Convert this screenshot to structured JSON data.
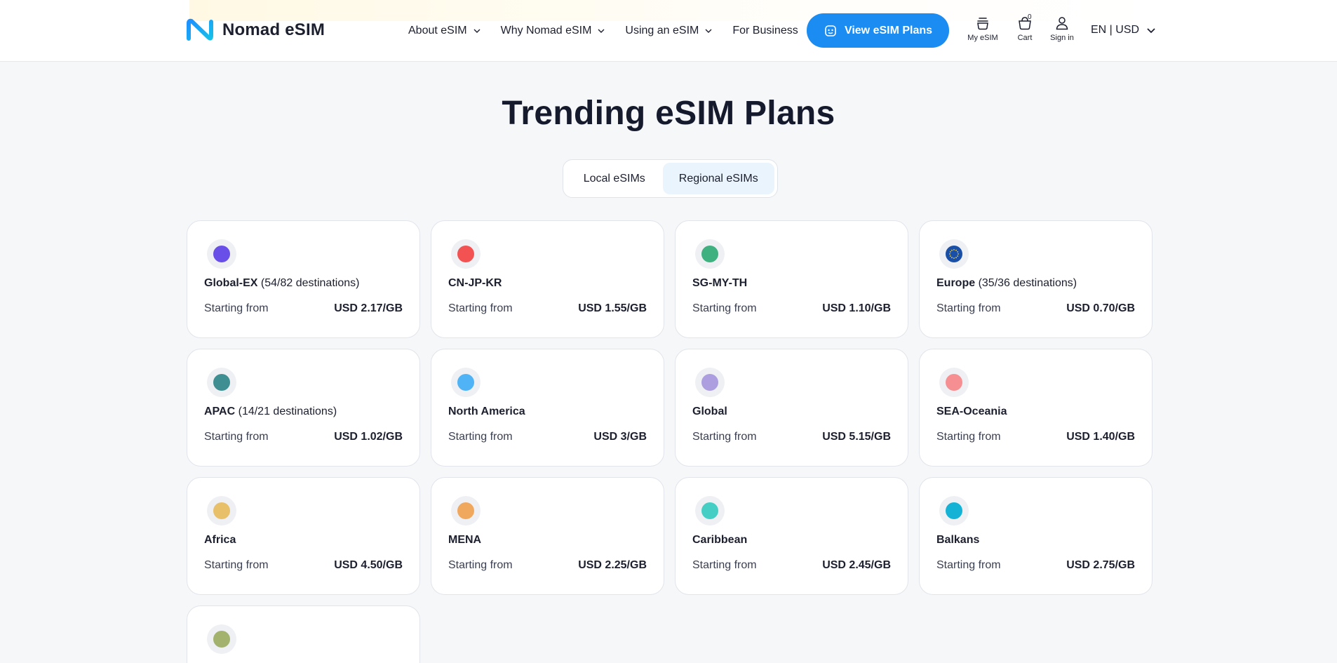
{
  "brand": {
    "name": "Nomad eSIM"
  },
  "nav": {
    "items": [
      {
        "label": "About eSIM",
        "dropdown": true
      },
      {
        "label": "Why Nomad eSIM",
        "dropdown": true
      },
      {
        "label": "Using an eSIM",
        "dropdown": true
      },
      {
        "label": "For Business",
        "dropdown": false
      }
    ],
    "cta_label": "View eSIM Plans",
    "my_esim_label": "My eSIM",
    "cart_label": "Cart",
    "cart_count": "0",
    "signin_label": "Sign in",
    "locale_label": "EN | USD"
  },
  "main": {
    "title": "Trending eSIM Plans",
    "tabs": [
      {
        "label": "Local eSIMs",
        "active": false
      },
      {
        "label": "Regional eSIMs",
        "active": true
      }
    ]
  },
  "plans": [
    {
      "name": "Global-EX",
      "extra": "(54/82 destinations)",
      "from_label": "Starting from",
      "price": "USD 2.17/GB",
      "color": "#6a4ee8"
    },
    {
      "name": "CN-JP-KR",
      "extra": "",
      "from_label": "Starting from",
      "price": "USD 1.55/GB",
      "color": "#f25252"
    },
    {
      "name": "SG-MY-TH",
      "extra": "",
      "from_label": "Starting from",
      "price": "USD 1.10/GB",
      "color": "#3fb07f"
    },
    {
      "name": "Europe",
      "extra": "(35/36 destinations)",
      "from_label": "Starting from",
      "price": "USD 0.70/GB",
      "color": "#1a4fa8"
    },
    {
      "name": "APAC",
      "extra": "(14/21 destinations)",
      "from_label": "Starting from",
      "price": "USD 1.02/GB",
      "color": "#3f8f92"
    },
    {
      "name": "North America",
      "extra": "",
      "from_label": "Starting from",
      "price": "USD 3/GB",
      "color": "#4fb3f5"
    },
    {
      "name": "Global",
      "extra": "",
      "from_label": "Starting from",
      "price": "USD 5.15/GB",
      "color": "#ad9ee0"
    },
    {
      "name": "SEA-Oceania",
      "extra": "",
      "from_label": "Starting from",
      "price": "USD 1.40/GB",
      "color": "#f58f92"
    },
    {
      "name": "Africa",
      "extra": "",
      "from_label": "Starting from",
      "price": "USD 4.50/GB",
      "color": "#e8c06a"
    },
    {
      "name": "MENA",
      "extra": "",
      "from_label": "Starting from",
      "price": "USD 2.25/GB",
      "color": "#f0a85e"
    },
    {
      "name": "Caribbean",
      "extra": "",
      "from_label": "Starting from",
      "price": "USD 2.45/GB",
      "color": "#45cfc4"
    },
    {
      "name": "Balkans",
      "extra": "",
      "from_label": "Starting from",
      "price": "USD 2.75/GB",
      "color": "#14b3d6"
    },
    {
      "name": "",
      "extra": "",
      "from_label": "",
      "price": "",
      "color": "#a3b36e"
    }
  ],
  "colors": {
    "accent": "#1b8cf2",
    "active_tab_bg": "#e9f4fd",
    "page_bg": "#f6f7f9"
  }
}
